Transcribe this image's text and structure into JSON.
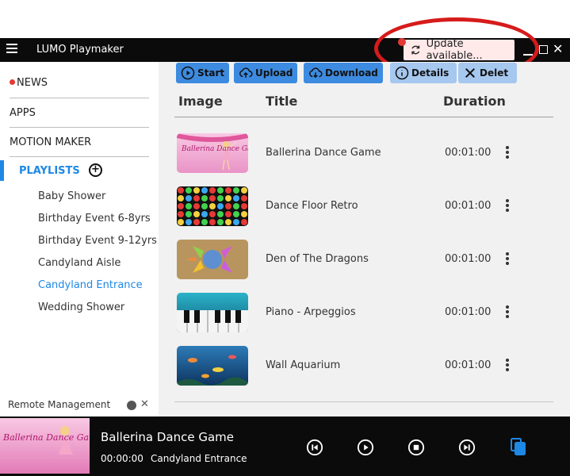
{
  "app": {
    "title": "LUMO Playmaker"
  },
  "update": {
    "label": "Update available..."
  },
  "sidebar": {
    "news": "NEWS",
    "apps": "APPS",
    "motion_maker": "MOTION MAKER",
    "playlists_label": "PLAYLISTS",
    "playlists": [
      {
        "label": "Baby Shower"
      },
      {
        "label": "Birthday Event 6-8yrs"
      },
      {
        "label": "Birthday Event 9-12yrs"
      },
      {
        "label": "Candyland Aisle"
      },
      {
        "label": "Candyland Entrance",
        "selected": true
      },
      {
        "label": "Wedding Shower"
      }
    ],
    "remote_management": "Remote Management"
  },
  "toolbar": {
    "start": "Start",
    "upload": "Upload",
    "download": "Download",
    "details": "Details",
    "delete": "Delet"
  },
  "table": {
    "columns": {
      "image": "Image",
      "title": "Title",
      "duration": "Duration"
    },
    "rows": [
      {
        "title": "Ballerina Dance Game",
        "duration": "00:01:00",
        "thumb": "ballerina"
      },
      {
        "title": "Dance Floor Retro",
        "duration": "00:01:00",
        "thumb": "dots"
      },
      {
        "title": "Den of The Dragons",
        "duration": "00:01:00",
        "thumb": "dragons"
      },
      {
        "title": "Piano - Arpeggios",
        "duration": "00:01:00",
        "thumb": "piano"
      },
      {
        "title": "Wall Aquarium",
        "duration": "00:01:00",
        "thumb": "aquarium"
      }
    ]
  },
  "player": {
    "title": "Ballerina Dance Game",
    "time": "00:00:00",
    "playlist": "Candyland Entrance"
  },
  "thumb_captions": {
    "ballerina": "Ballerina Dance Game"
  },
  "colors": {
    "accent": "#1e88e5",
    "toolbar": "#3d8be0",
    "alert": "#d61b1b"
  }
}
